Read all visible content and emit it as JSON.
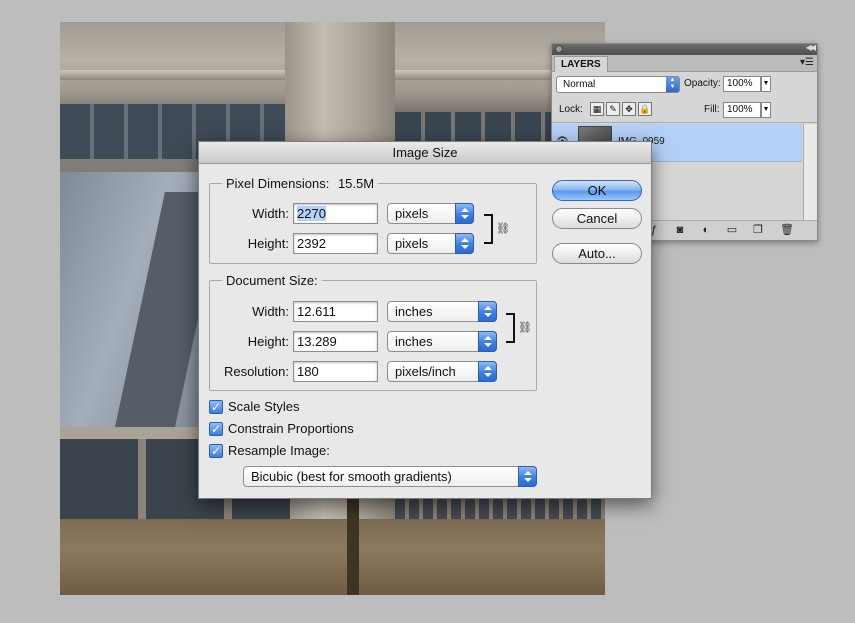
{
  "layers_panel": {
    "tab": "LAYERS",
    "blend_mode": "Normal",
    "opacity_label": "Opacity:",
    "opacity_value": "100%",
    "lock_label": "Lock:",
    "fill_label": "Fill:",
    "fill_value": "100%",
    "layer_name": "IMG_0959"
  },
  "dialog": {
    "title": "Image Size",
    "pixel_dimensions": {
      "legend": "Pixel Dimensions:",
      "size": "15.5M",
      "width_label": "Width:",
      "width_value": "2270",
      "width_unit": "pixels",
      "height_label": "Height:",
      "height_value": "2392",
      "height_unit": "pixels"
    },
    "document_size": {
      "legend": "Document Size:",
      "width_label": "Width:",
      "width_value": "12.611",
      "width_unit": "inches",
      "height_label": "Height:",
      "height_value": "13.289",
      "height_unit": "inches",
      "resolution_label": "Resolution:",
      "resolution_value": "180",
      "resolution_unit": "pixels/inch"
    },
    "checkboxes": {
      "scale_styles": "Scale Styles",
      "constrain": "Constrain Proportions",
      "resample": "Resample Image:"
    },
    "resample_method": "Bicubic (best for smooth gradients)",
    "buttons": {
      "ok": "OK",
      "cancel": "Cancel",
      "auto": "Auto..."
    }
  },
  "colors": {
    "accent": "#3e7fe0",
    "selected_layer": "#b5d0f7"
  }
}
